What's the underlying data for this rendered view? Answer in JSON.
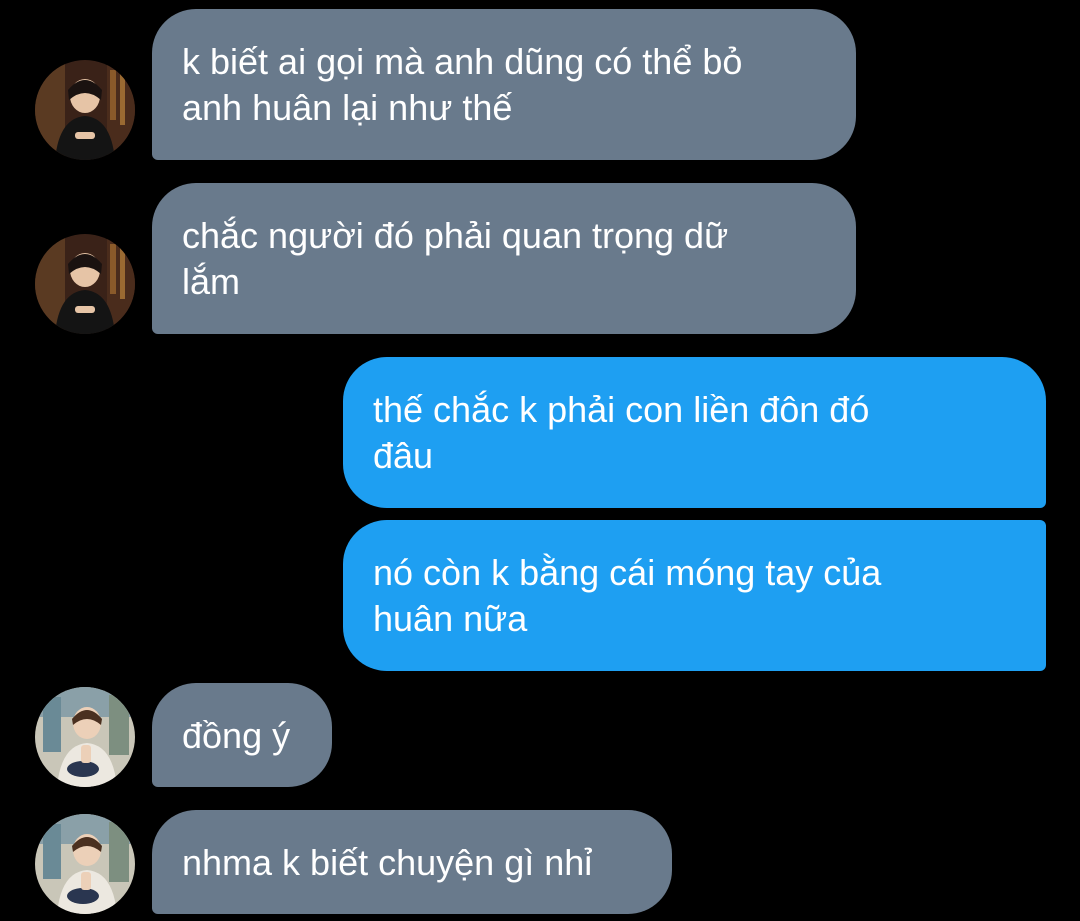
{
  "colors": {
    "background": "#000000",
    "incoming_bubble": "#697a8c",
    "outgoing_bubble": "#1e9ff2",
    "text": "#ffffff"
  },
  "messages": [
    {
      "sender": "other",
      "text": "k biết ai gọi mà anh dũng có thể bỏ\nanh huân lại như thế"
    },
    {
      "sender": "other",
      "text": "chắc người đó phải quan trọng dữ\nlắm"
    },
    {
      "sender": "me",
      "text": "thế chắc k phải con liền đôn đó\nđâu"
    },
    {
      "sender": "me",
      "text": "nó còn k bằng cái móng tay của\nhuân nữa"
    },
    {
      "sender": "other",
      "text": "đồng ý"
    },
    {
      "sender": "other",
      "text": "nhma k biết chuyện gì nhỉ"
    }
  ],
  "avatars": [
    {
      "icon": "user-avatar-icon",
      "tone": "dark"
    },
    {
      "icon": "user-avatar-icon",
      "tone": "dark"
    },
    {
      "icon": "user-avatar-icon",
      "tone": "light"
    },
    {
      "icon": "user-avatar-icon",
      "tone": "light"
    }
  ]
}
